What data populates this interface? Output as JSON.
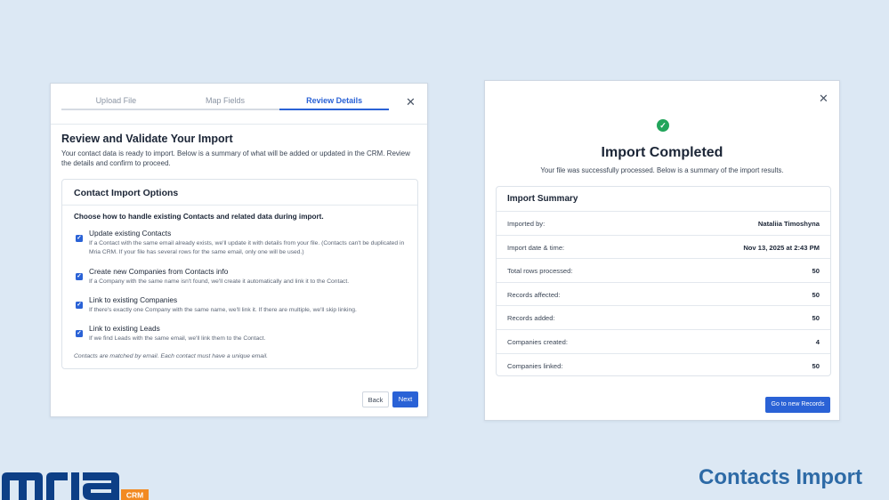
{
  "left_modal": {
    "tabs": [
      {
        "label": "Upload File",
        "active": false
      },
      {
        "label": "Map Fields",
        "active": false
      },
      {
        "label": "Review Details",
        "active": true
      }
    ],
    "title": "Review and Validate Your Import",
    "description": "Your contact data is ready to import. Below is a summary of what will be added or updated in the CRM. Review the details and confirm to proceed.",
    "options_card": {
      "title": "Contact Import Options",
      "subtitle": "Choose how to handle existing Contacts and related data during import.",
      "options": [
        {
          "label": "Update existing Contacts",
          "help": "If a Contact with the same email already exists, we'll update it with details from your file. (Contacts can't be duplicated in Mria CRM. If your file has several rows for the same email, only one will be used.)",
          "checked": true
        },
        {
          "label": "Create new Companies from Contacts info",
          "help": "If a Company with the same name isn't found, we'll create it automatically and link it to the Contact.",
          "checked": true
        },
        {
          "label": "Link to existing Companies",
          "help": "If there's exactly one Company with the same name, we'll link it. If there are multiple, we'll skip linking.",
          "checked": true
        },
        {
          "label": "Link to existing Leads",
          "help": "If we find Leads with the same email, we'll link them to the Contact.",
          "checked": true
        }
      ],
      "note": "Contacts are matched by email. Each contact must have a unique email."
    },
    "back_label": "Back",
    "next_label": "Next"
  },
  "right_modal": {
    "title": "Import Completed",
    "description": "Your file was successfully processed. Below is a summary of the import results.",
    "summary": {
      "title": "Import Summary",
      "rows": [
        {
          "label": "Imported by:",
          "value": "Nataliia Timoshyna"
        },
        {
          "label": "Import date & time:",
          "value": "Nov 13, 2025 at 2:43 PM"
        },
        {
          "label": "Total rows processed:",
          "value": "50"
        },
        {
          "label": "Records affected:",
          "value": "50"
        },
        {
          "label": "Records added:",
          "value": "50"
        },
        {
          "label": "Companies created:",
          "value": "4"
        },
        {
          "label": "Companies linked:",
          "value": "50"
        }
      ]
    },
    "go_label": "Go to new Records"
  },
  "branding": {
    "logo_text": "mria",
    "logo_badge": "CRM",
    "footer_title": "Contacts Import"
  },
  "colors": {
    "background": "#dce8f4",
    "accent": "#2a62d6",
    "success": "#22a55b",
    "brand_blue": "#0d3f86",
    "brand_orange": "#f28a22",
    "footer_title": "#2d6aa6"
  },
  "icons": [
    "close-icon",
    "check-icon",
    "success-check-icon"
  ]
}
